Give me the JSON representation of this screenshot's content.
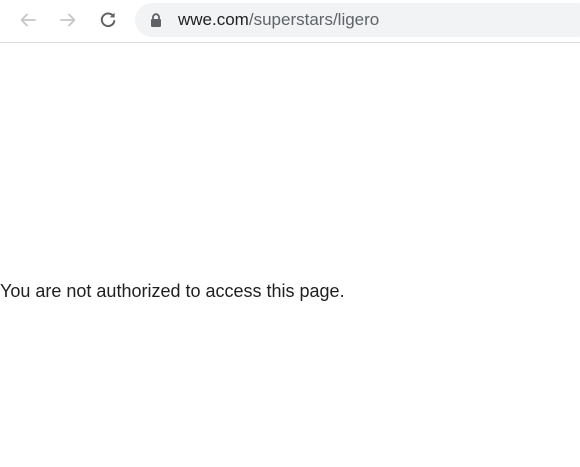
{
  "browser": {
    "url_host": "wwe.com",
    "url_path": "/superstars/ligero",
    "icons": {
      "back": "arrow-left-icon",
      "forward": "arrow-right-icon",
      "reload": "reload-icon",
      "security": "lock-icon"
    },
    "colors": {
      "nav_disabled": "#c4c7c5",
      "nav_active": "#5f6368",
      "omnibox_bg": "#f1f3f4"
    }
  },
  "page": {
    "message": "You are not authorized to access this page."
  }
}
